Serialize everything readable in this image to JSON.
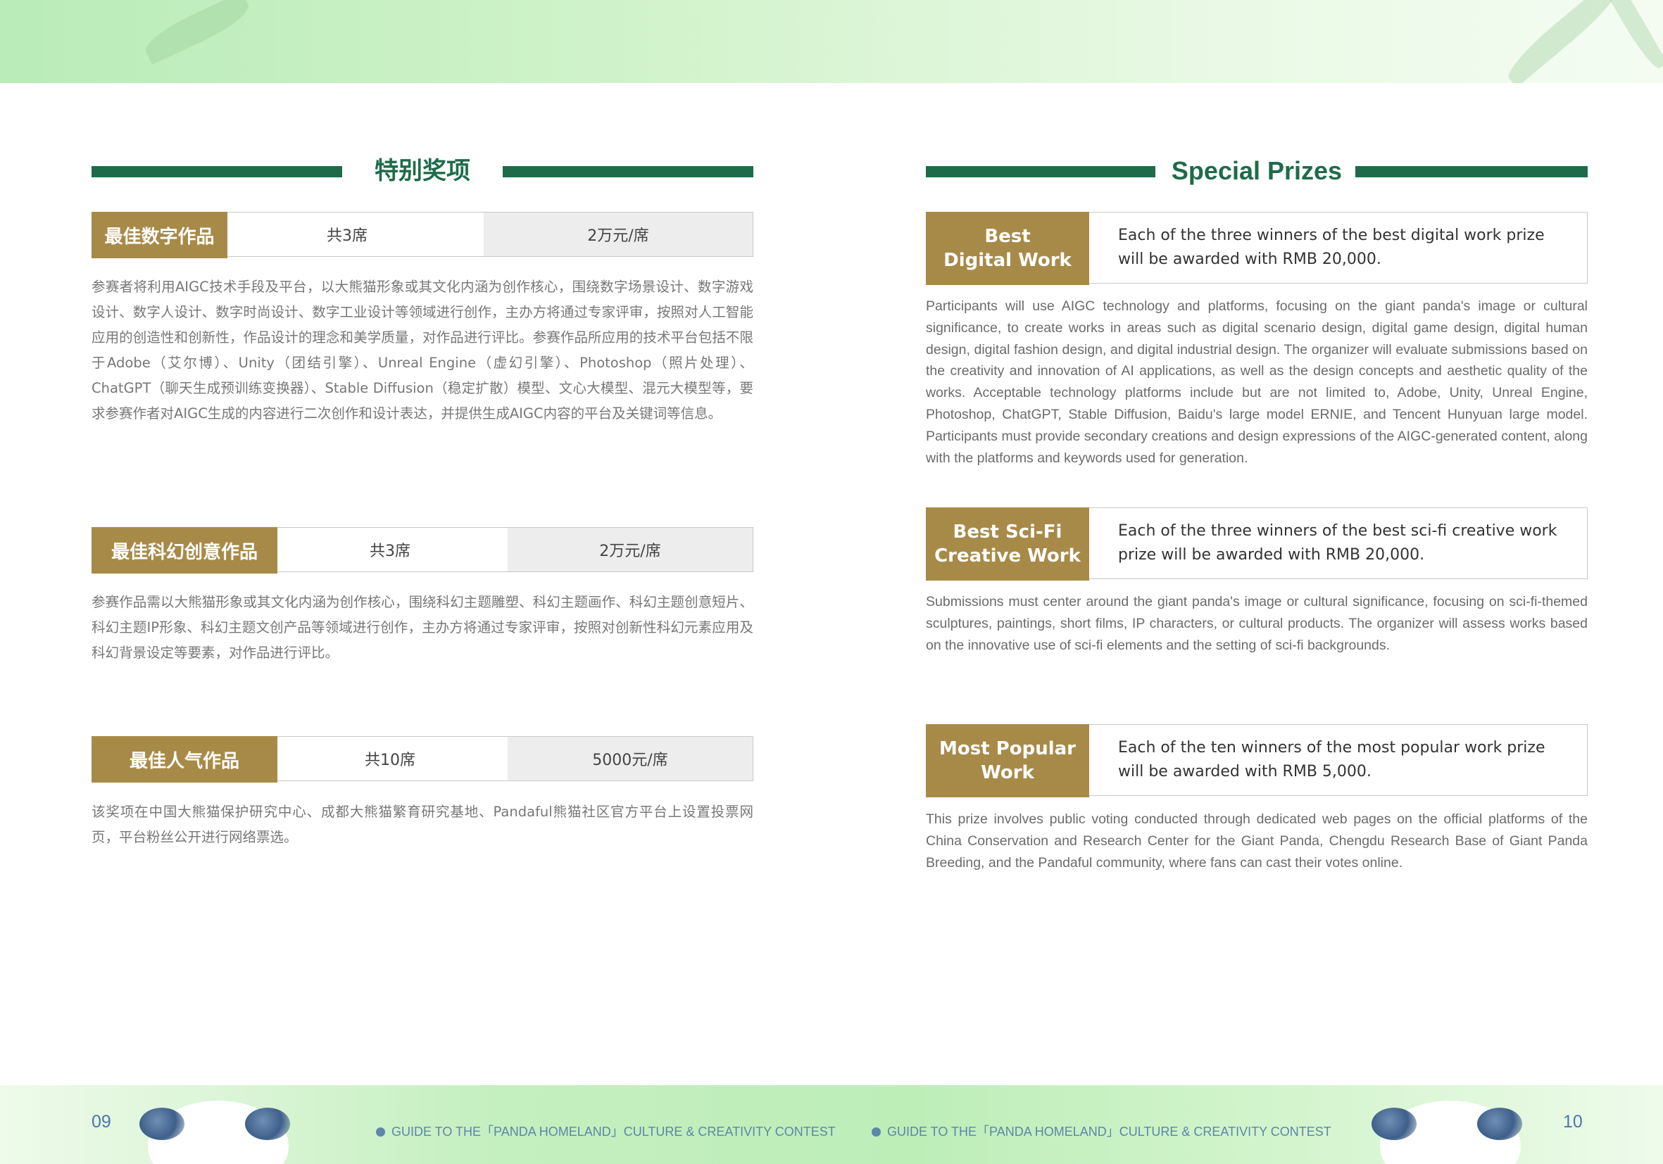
{
  "left": {
    "heading": "特别奖项",
    "prizes": [
      {
        "name": "最佳数字作品",
        "count": "共3席",
        "amount": "2万元/席",
        "description": "参赛者将利用AIGC技术手段及平台，以大熊猫形象或其文化内涵为创作核心，围绕数字场景设计、数字游戏设计、数字人设计、数字时尚设计、数字工业设计等领域进行创作，主办方将通过专家评审，按照对人工智能应用的创造性和创新性，作品设计的理念和美学质量，对作品进行评比。参赛作品所应用的技术平台包括不限于Adobe（艾尔博）、Unity（团结引擎）、Unreal Engine（虚幻引擎）、Photoshop（照片处理）、ChatGPT（聊天生成预训练变换器）、Stable Diffusion（稳定扩散）模型、文心大模型、混元大模型等，要求参赛作者对AIGC生成的内容进行二次创作和设计表达，并提供生成AIGC内容的平台及关键词等信息。"
      },
      {
        "name": "最佳科幻创意作品",
        "count": "共3席",
        "amount": "2万元/席",
        "description": "参赛作品需以大熊猫形象或其文化内涵为创作核心，围绕科幻主题雕塑、科幻主题画作、科幻主题创意短片、科幻主题IP形象、科幻主题文创产品等领域进行创作，主办方将通过专家评审，按照对创新性科幻元素应用及科幻背景设定等要素，对作品进行评比。"
      },
      {
        "name": "最佳人气作品",
        "count": "共10席",
        "amount": "5000元/席",
        "description": "该奖项在中国大熊猫保护研究中心、成都大熊猫繁育研究基地、Pandaful熊猫社区官方平台上设置投票网页，平台粉丝公开进行网络票选。"
      }
    ]
  },
  "right": {
    "heading": "Special Prizes",
    "prizes": [
      {
        "name_line1": "Best",
        "name_line2": "Digital Work",
        "summary": "Each of the three winners of the best digital work prize will be awarded with RMB 20,000.",
        "description": "Participants will use AIGC technology and platforms, focusing on the giant panda's image or cultural significance, to create works in areas such as digital scenario design, digital game design, digital human design, digital fashion design, and digital industrial design. The organizer will evaluate submissions based on the creativity and innovation of AI applications, as well as the design concepts and aesthetic quality of the works. Acceptable technology platforms include but are not limited to, Adobe, Unity, Unreal Engine, Photoshop, ChatGPT, Stable Diffusion, Baidu's large model ERNIE, and Tencent Hunyuan large model. Participants must provide secondary creations and design expressions of the AIGC-generated content, along with the platforms and keywords used for generation."
      },
      {
        "name_line1": "Best Sci-Fi",
        "name_line2": "Creative Work",
        "summary": "Each of the three winners of the best sci-fi creative work prize will be awarded with RMB 20,000.",
        "description": "Submissions must center around the giant panda's image or cultural significance, focusing on sci-fi-themed sculptures, paintings, short films, IP characters, or cultural products. The organizer will assess works based on the innovative use of sci-fi elements and the setting of sci-fi backgrounds."
      },
      {
        "name_line1": "Most Popular",
        "name_line2": "Work",
        "summary": "Each of the ten winners of the most popular work prize will be awarded with RMB 5,000.",
        "description": "This prize involves public voting conducted through dedicated web pages on the official platforms of the China Conservation and Research Center for the Giant Panda, Chengdu Research Base of Giant Panda Breeding, and the Pandaful community, where fans can cast their votes online."
      }
    ]
  },
  "footer": {
    "page_left": "09",
    "page_right": "10",
    "guide_left": "GUIDE TO THE「PANDA HOMELAND」CULTURE & CREATIVITY CONTEST",
    "guide_right": "GUIDE TO THE「PANDA HOMELAND」CULTURE & CREATIVITY CONTEST"
  },
  "colors": {
    "heading_green": "#1e6b4a",
    "label_gold": "#a88a48",
    "footer_blue": "#5c86aa"
  }
}
